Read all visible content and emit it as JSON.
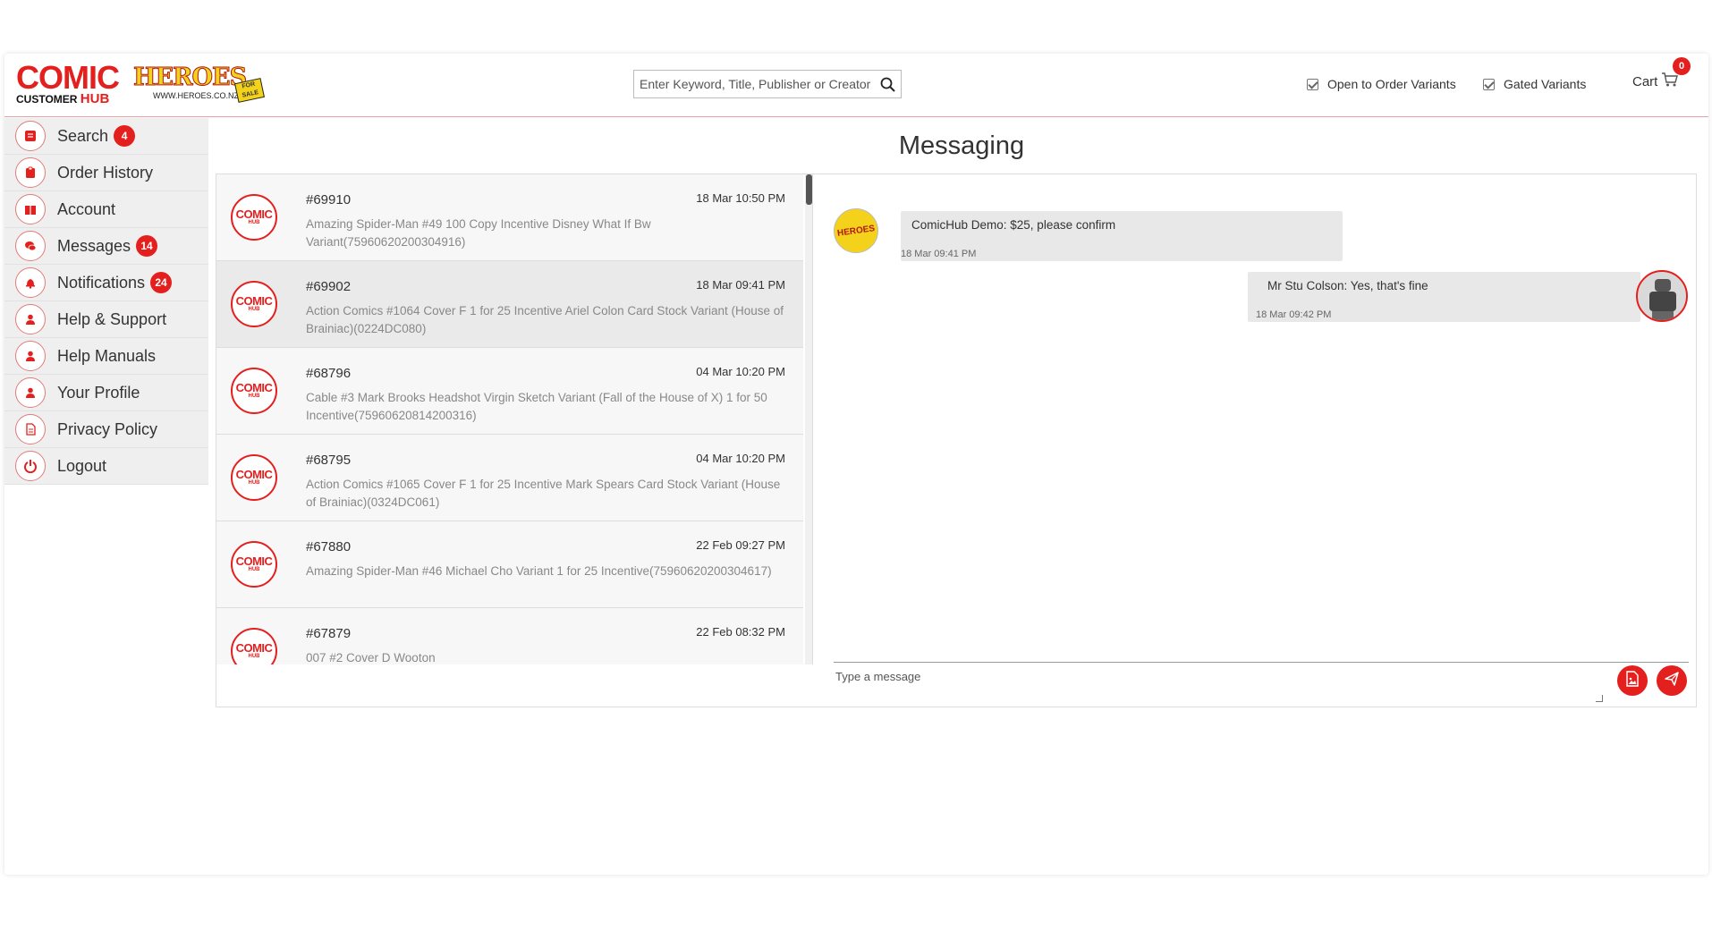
{
  "header": {
    "logo": {
      "comic": "COMIC",
      "customer": "CUSTOMER",
      "hub": "HUB"
    },
    "partner_logo": {
      "name": "HEROES",
      "url": "WWW.HEROES.CO.NZ",
      "badge": "FOR SALE"
    },
    "search": {
      "placeholder": "Enter Keyword, Title, Publisher or Creator"
    },
    "filters": [
      {
        "label": "Open to Order Variants",
        "checked": true
      },
      {
        "label": "Gated Variants",
        "checked": true
      }
    ],
    "cart": {
      "label": "Cart",
      "count": "0"
    }
  },
  "sidebar": {
    "items": [
      {
        "label": "Search",
        "badge": "4"
      },
      {
        "label": "Order History",
        "badge": ""
      },
      {
        "label": "Account",
        "badge": ""
      },
      {
        "label": "Messages",
        "badge": "14"
      },
      {
        "label": "Notifications",
        "badge": "24"
      },
      {
        "label": "Help & Support",
        "badge": ""
      },
      {
        "label": "Help Manuals",
        "badge": ""
      },
      {
        "label": "Your Profile",
        "badge": ""
      },
      {
        "label": "Privacy Policy",
        "badge": ""
      },
      {
        "label": "Logout",
        "badge": ""
      }
    ]
  },
  "page": {
    "title": "Messaging"
  },
  "threads": [
    {
      "id": "#69910",
      "time": "18 Mar 10:50 PM",
      "desc": "Amazing Spider-Man #49 100 Copy Incentive Disney What If Bw Variant(75960620200304916)"
    },
    {
      "id": "#69902",
      "time": "18 Mar 09:41 PM",
      "desc": "Action Comics #1064 Cover F 1 for 25 Incentive Ariel Colon Card Stock Variant (House of Brainiac)(0224DC080)"
    },
    {
      "id": "#68796",
      "time": "04 Mar 10:20 PM",
      "desc": "Cable #3 Mark Brooks Headshot Virgin Sketch Variant (Fall of the House of X) 1 for 50 Incentive(75960620814200316)"
    },
    {
      "id": "#68795",
      "time": "04 Mar 10:20 PM",
      "desc": "Action Comics #1065 Cover F 1 for 25 Incentive Mark Spears Card Stock Variant (House of Brainiac)(0324DC061)"
    },
    {
      "id": "#67880",
      "time": "22 Feb 09:27 PM",
      "desc": "Amazing Spider-Man #46 Michael Cho Variant 1 for 25 Incentive(75960620200304617)"
    },
    {
      "id": "#67879",
      "time": "22 Feb 08:32 PM",
      "desc": "007 #2 Cover D Wooton"
    }
  ],
  "thread_avatar": {
    "line1": "COMIC",
    "line2": "HUB"
  },
  "chat": {
    "incoming_avatar": "HEROES",
    "messages": [
      {
        "text": "ComicHub Demo: $25, please confirm",
        "time": "18 Mar 09:41 PM",
        "direction": "in"
      },
      {
        "text": "Mr Stu Colson: Yes, that's fine",
        "time": "18 Mar 09:42 PM",
        "direction": "out"
      }
    ],
    "composer_placeholder": "Type a message"
  },
  "colors": {
    "accent": "#e4201e",
    "sidebar_bg": "#efefef",
    "bubble_bg": "#e8e8e8"
  }
}
